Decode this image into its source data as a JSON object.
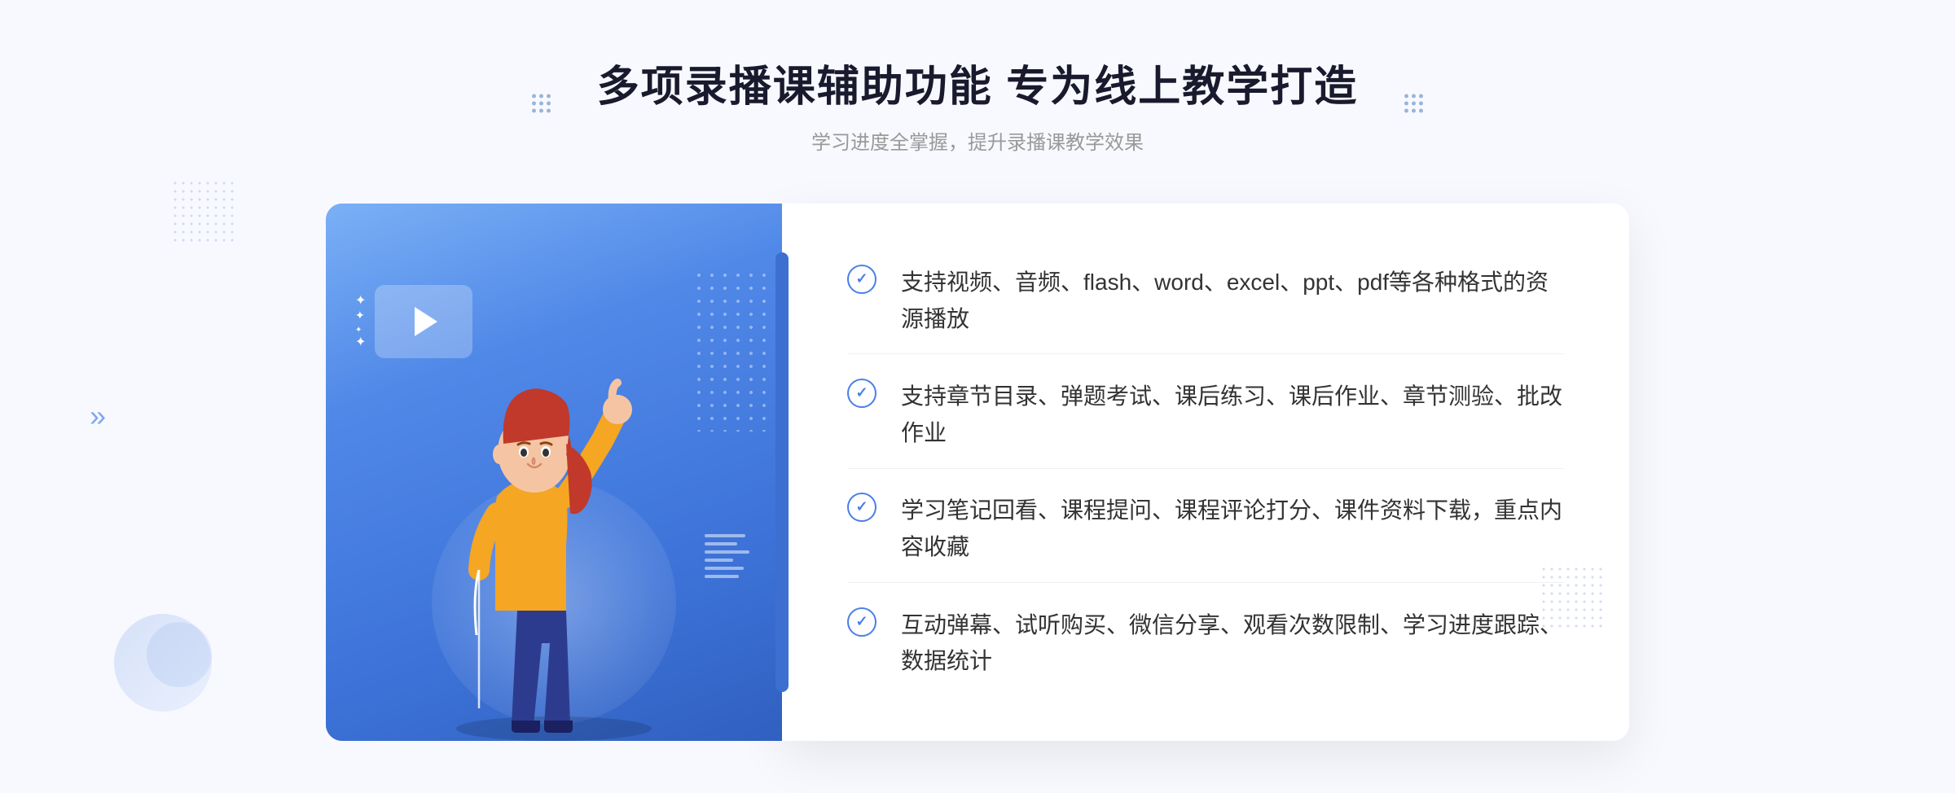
{
  "page": {
    "background_color": "#f0f4ff"
  },
  "header": {
    "title": "多项录播课辅助功能 专为线上教学打造",
    "subtitle": "学习进度全掌握，提升录播课教学效果",
    "deco_dots_count": 9
  },
  "features": [
    {
      "id": 1,
      "text": "支持视频、音频、flash、word、excel、ppt、pdf等各种格式的资源播放"
    },
    {
      "id": 2,
      "text": "支持章节目录、弹题考试、课后练习、课后作业、章节测验、批改作业"
    },
    {
      "id": 3,
      "text": "学习笔记回看、课程提问、课程评论打分、课件资料下载，重点内容收藏"
    },
    {
      "id": 4,
      "text": "互动弹幕、试听购买、微信分享、观看次数限制、学习进度跟踪、数据统计"
    }
  ],
  "left_panel": {
    "gradient_start": "#7ab0f5",
    "gradient_end": "#3060c0"
  },
  "icons": {
    "check": "✓",
    "play": "▶",
    "arrow_double": "»",
    "sparkle": "✦"
  }
}
